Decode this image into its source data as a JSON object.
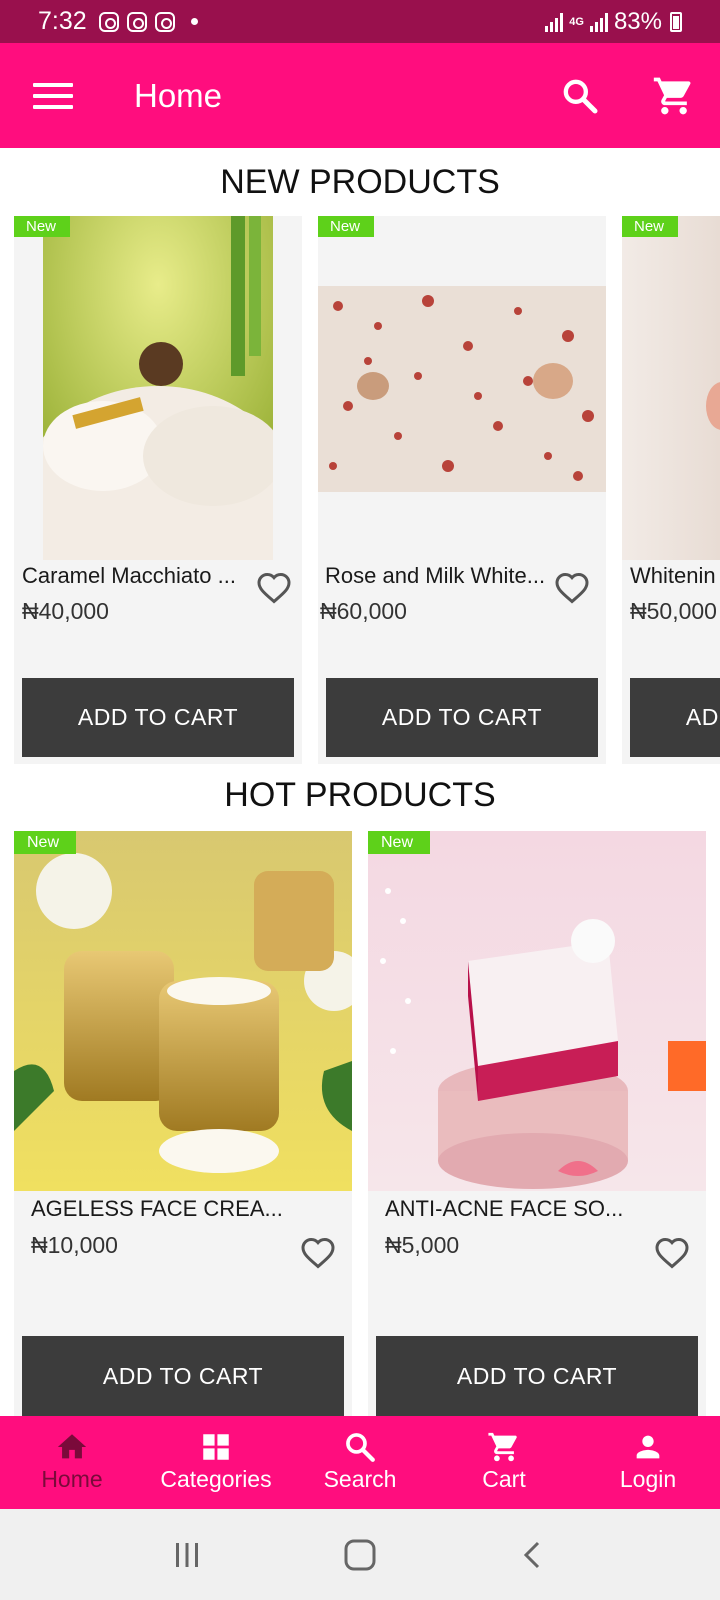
{
  "status_bar": {
    "time": "7:32",
    "network": "4G",
    "battery": "83%"
  },
  "app_bar": {
    "title": "Home"
  },
  "sections": {
    "new_title": "NEW PRODUCTS",
    "hot_title": "HOT PRODUCTS"
  },
  "new_products": [
    {
      "badge": "New",
      "name": "Caramel Macchiato ...",
      "price": "₦40,000",
      "button": "ADD TO CART"
    },
    {
      "badge": "New",
      "name": "Rose and Milk White...",
      "price": "₦60,000",
      "button": "ADD TO CART"
    },
    {
      "badge": "New",
      "name": "Whitenin",
      "price": "₦50,000",
      "button": "ADD TO CART"
    }
  ],
  "hot_products": [
    {
      "badge": "New",
      "name": "AGELESS FACE CREA...",
      "price": "₦10,000",
      "button": "ADD TO CART"
    },
    {
      "badge": "New",
      "name": "ANTI-ACNE FACE SO...",
      "price": "₦5,000",
      "button": "ADD TO CART"
    }
  ],
  "bottom_nav": {
    "items": [
      {
        "label": "Home",
        "icon": "home-icon"
      },
      {
        "label": "Categories",
        "icon": "grid-icon"
      },
      {
        "label": "Search",
        "icon": "search-icon"
      },
      {
        "label": "Cart",
        "icon": "cart-icon"
      },
      {
        "label": "Login",
        "icon": "person-icon"
      }
    ]
  },
  "colors": {
    "status_bar": "#99104d",
    "primary": "#ff0d7e",
    "badge": "#5ed11a",
    "button": "#3c3c3c",
    "nav_active": "#7a0a3a"
  }
}
